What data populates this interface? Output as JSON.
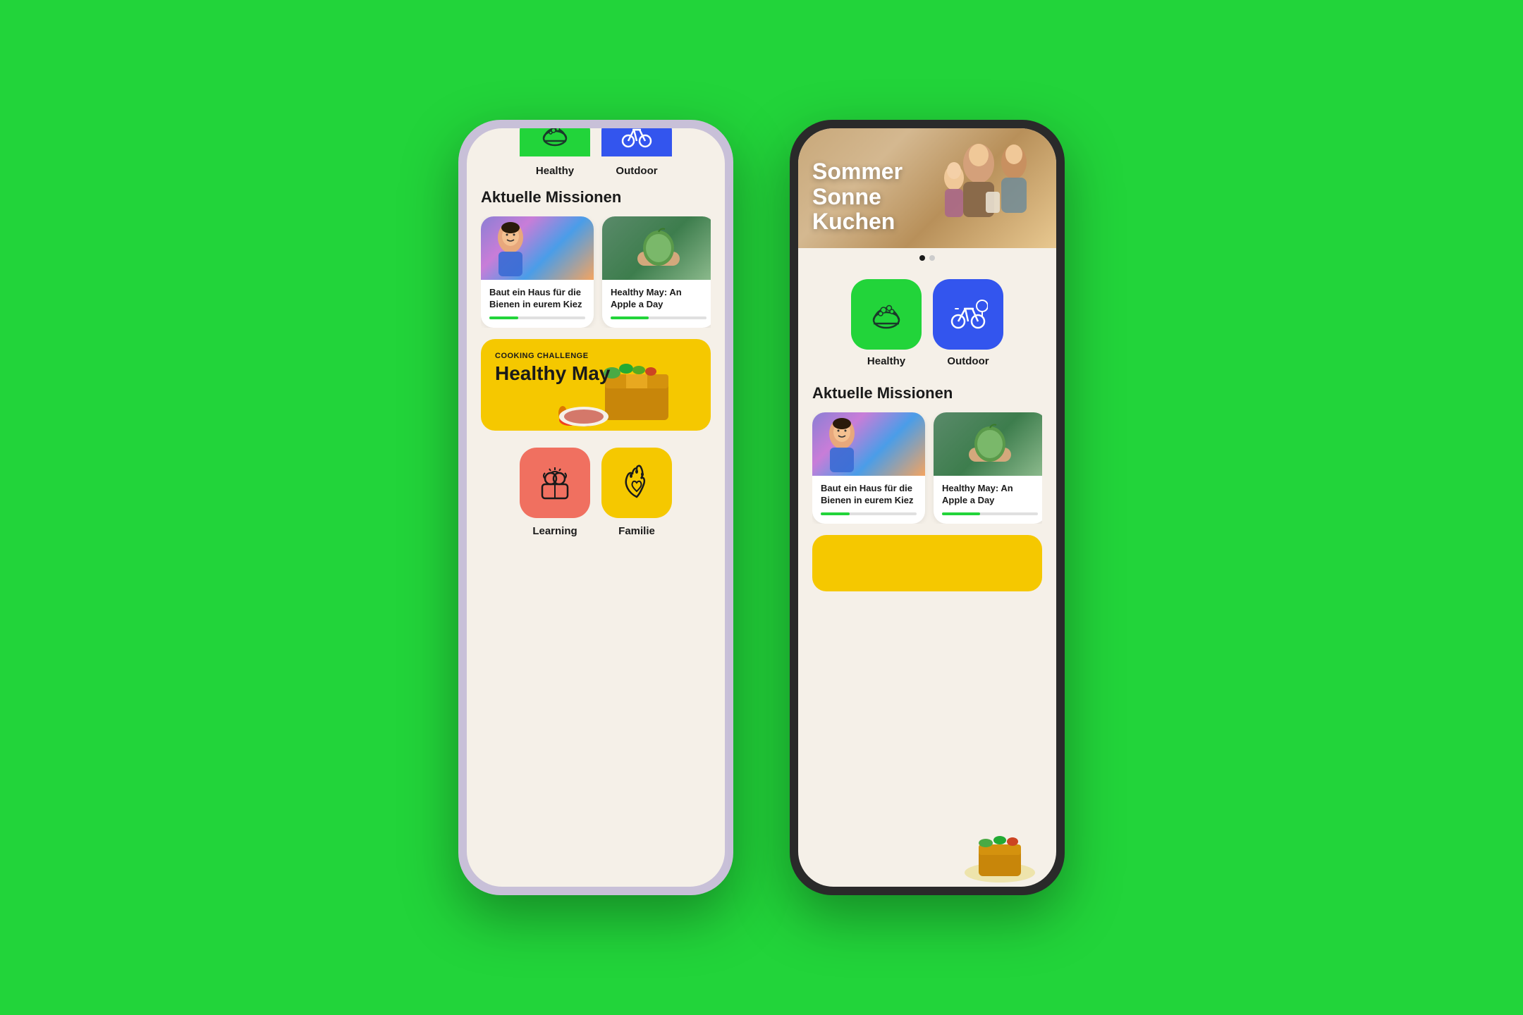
{
  "app": {
    "background_color": "#22d43a"
  },
  "phone_left": {
    "categories": [
      {
        "id": "healthy",
        "label": "Healthy",
        "color": "green"
      },
      {
        "id": "outdoor",
        "label": "Outdoor",
        "color": "blue"
      }
    ],
    "section_title": "Aktuelle Missionen",
    "missions": [
      {
        "id": "bienen",
        "title": "Baut ein Haus für die Bienen in eurem Kiez",
        "progress": 30
      },
      {
        "id": "apple",
        "title": "Healthy May: An Apple a Day",
        "progress": 40
      }
    ],
    "challenge": {
      "label": "COOKING CHALLENGE",
      "title": "Healthy May"
    },
    "bottom_categories": [
      {
        "id": "learning",
        "label": "Learning",
        "color": "salmon"
      },
      {
        "id": "familie",
        "label": "Familie",
        "color": "yellow"
      }
    ]
  },
  "phone_right": {
    "hero": {
      "title": "Sommer\nSonne\nKuchen"
    },
    "dots": [
      {
        "active": true
      },
      {
        "active": false
      }
    ],
    "categories": [
      {
        "id": "healthy",
        "label": "Healthy",
        "color": "green"
      },
      {
        "id": "outdoor",
        "label": "Outdoor",
        "color": "blue"
      }
    ],
    "section_title": "Aktuelle Missionen",
    "missions": [
      {
        "id": "bienen",
        "title": "Baut ein Haus für die Bienen in eurem Kiez",
        "progress": 30
      },
      {
        "id": "apple",
        "title": "Healthy May: An Apple a Day",
        "progress": 40
      }
    ],
    "challenge_partial": {
      "color": "#f5c800"
    }
  }
}
